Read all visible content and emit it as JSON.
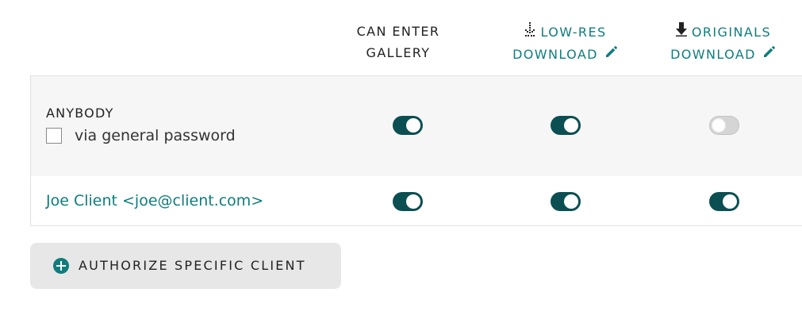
{
  "columns": {
    "enter": {
      "line1": "CAN ENTER",
      "line2": "GALLERY",
      "icon": null
    },
    "lowres": {
      "line1": "LOW-RES",
      "line2": "DOWNLOAD",
      "icon": "low-res-download-icon",
      "edit_icon": "pencil-icon"
    },
    "originals": {
      "line1": "ORIGINALS",
      "line2": "DOWNLOAD",
      "icon": "download-arrow-icon",
      "edit_icon": "pencil-icon"
    }
  },
  "rows": {
    "anybody": {
      "title": "ANYBODY",
      "password_checkbox": {
        "label": "via general password",
        "checked": false
      },
      "can_enter": true,
      "lowres_download": true,
      "originals_download": false
    },
    "client": {
      "name": "Joe Client <joe@client.com>",
      "can_enter": true,
      "lowres_download": true,
      "originals_download": true
    }
  },
  "authorize_button": {
    "label": "AUTHORIZE SPECIFIC CLIENT",
    "icon": "plus-circle-icon"
  },
  "colors": {
    "accent": "#0f7d7d",
    "toggle_on": "#0b4f52",
    "toggle_off": "#d5d5d5",
    "row_highlight": "#f6f6f6",
    "button_bg": "#e7e7e7"
  }
}
